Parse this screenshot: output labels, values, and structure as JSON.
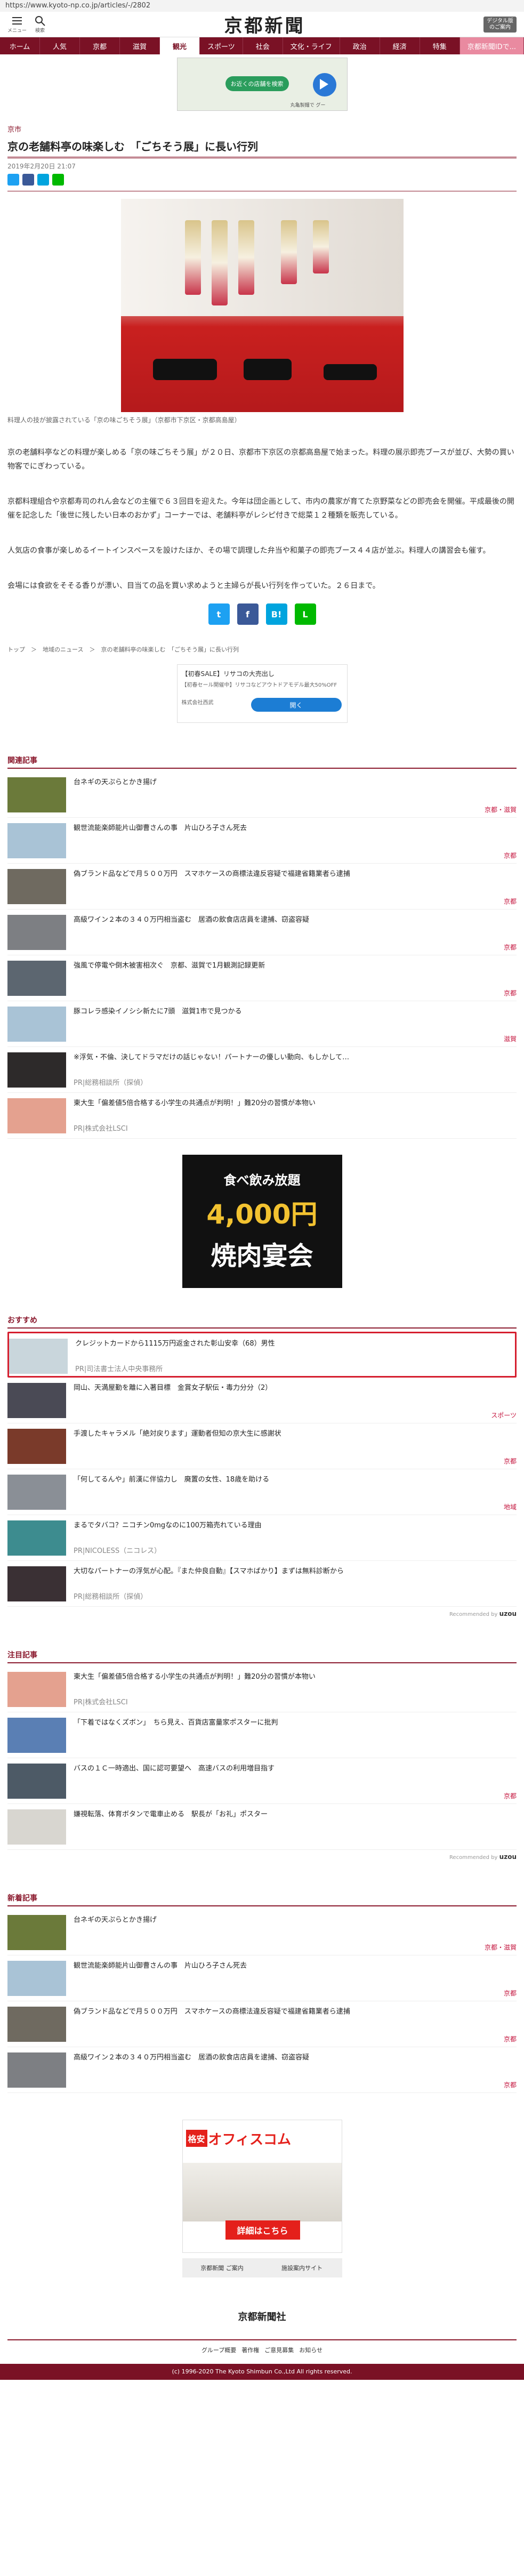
{
  "url": "https://www.kyoto-np.co.jp/articles/-/2802",
  "header": {
    "menu_label": "メニュー",
    "search_label": "検索",
    "logo": "京都新聞",
    "digital": "デジタル版\nのご案内"
  },
  "nav": [
    "ホーム",
    "人気",
    "京都",
    "滋賀",
    "観光",
    "スポーツ",
    "社会",
    "文化・ライフ",
    "政治",
    "経済",
    "特集",
    "京都新聞IDで..."
  ],
  "mapad": {
    "button": "お近くの店舗を検索",
    "caption": "丸亀製麺で グー"
  },
  "article": {
    "section": "京市",
    "title": "京の老舗料亭の味楽しむ　「ごちそう展」に長い行列",
    "date": "2019年2月20日 21:07",
    "caption": "料理人の技が披露されている「京の味ごちそう展」（京都市下京区・京都高島屋）",
    "p1": "京の老舗料亭などの料理が楽しめる「京の味ごちそう展」が２０日、京都市下京区の京都高島屋で始まった。料理の展示即売ブースが並び、大勢の買い物客でにぎわっている。",
    "p2": "京都料理組合や京都寿司のれん会などの主催で６３回目を迎えた。今年は団企画として、市内の農家が育てた京野菜などの即売会を開催。平成最後の開催を記念した「後世に残したい日本のおかず」コーナーでは、老舗料亭がレシピ付きで総菜１２種類を販売している。",
    "p3": "人気店の食事が楽しめるイートインスペースを設けたほか、その場で調理した弁当や和菓子の即売ブース４４店が並ぶ。料理人の講習会も催す。",
    "p4": "会場には食欲をそそる香りが漂い、目当ての品を買い求めようと主婦らが長い行列を作っていた。２６日まで。",
    "crumb": "トップ　＞　地域のニュース　＞　京の老舗料亭の味楽しむ　「ごちそう展」に長い行列"
  },
  "share": [
    "t",
    "f",
    "B!",
    "L"
  ],
  "ad_small": {
    "line1": "【初春SALE】リサコの大売出し",
    "line2": "【初春セール開催中】リサコなどアウトドアモデル最大50%OFF",
    "line3": "株式会社西武",
    "button": "開く"
  },
  "related": {
    "heading": "関連記事",
    "items": [
      {
        "title": "台ネギの天ぷらとかき揚げ",
        "tag": "京都・滋賀"
      },
      {
        "title": "観世流能楽師能片山御曹さんの事　片山ひろ子さん死去",
        "tag": "京都"
      },
      {
        "title": "偽ブランド品などで月５００万円　スマホケースの商標法違反容疑で福建省籍業者ら逮捕",
        "tag": "京都"
      },
      {
        "title": "高級ワイン２本の３４０万円相当盗む　居酒の飲食店店員を逮捕、窃盗容疑",
        "tag": "京都"
      },
      {
        "title": "強風で停電や倒木被害相次ぐ　京都、滋賀で1月観測記録更新",
        "tag": "京都"
      },
      {
        "title": "豚コレラ感染イノシシ新たに7頭　滋賀1市で見つかる",
        "tag": "滋賀"
      },
      {
        "title": "※浮気・不倫、決してドラマだけの話じゃない！パートナーの優しい動向、もしかして…",
        "pr": "PR|総務相談所（探偵）"
      },
      {
        "title": "東大生「偏差値5倍合格する小学生の共通点が判明！」難20分の習慣が本物い",
        "pr": "PR|株式会社LSCI"
      }
    ]
  },
  "bigad": {
    "l1": "食べ飲み放題",
    "l2": "4,000円",
    "l3": "焼肉宴会"
  },
  "recommend": {
    "heading": "おすすめ",
    "items": [
      {
        "title": "クレジットカードから1115万円返金された彰山安幸（68）男性",
        "pr": "PR|司法書士法人中央事務所"
      },
      {
        "title": "岡山、天満屋勤を離に入著目標　金賞女子駅伝・毒力分分（2）",
        "tag": "スポーツ"
      },
      {
        "title": "手渡したキャラメル「絶対戻ります」運動者但知の京大生に感謝状",
        "tag": "京都"
      },
      {
        "title": "「何してるんや」前漢に伴協力し　廃置の女性、18歳を助ける",
        "tag": "地域"
      },
      {
        "title": "まるでタバコ？ニコチン0mgなのに100万箱売れている理由",
        "pr": "PR|NICOLESS（ニコレス）"
      },
      {
        "title": "大切なパートナーの浮気が心配。『また仲良自動』【スマホばかり】まずは無料診断から",
        "pr": "PR|総務相談所（探偵）"
      }
    ],
    "recby": "Recommended by",
    "recbrand": "uzou"
  },
  "attention": {
    "heading": "注目記事",
    "items": [
      {
        "title": "東大生「偏差値5倍合格する小学生の共通点が判明！」難20分の習慣が本物い",
        "pr": "PR|株式会社LSCI"
      },
      {
        "title": "「下着ではなくズボン」　ちら見え、百貨店富量家ポスターに批判",
        "tag": ""
      },
      {
        "title": "バスの１Ｃ一時適出、国に認可要望へ　高速バスの利用増目指す",
        "tag": "京都"
      },
      {
        "title": "嫌視転落、体育ボタンで電車止める　駅長が「お礼」ポスター",
        "tag": ""
      }
    ],
    "recby": "Recommended by",
    "recbrand": "uzou"
  },
  "latest": {
    "heading": "新着記事",
    "items": [
      {
        "title": "台ネギの天ぷらとかき揚げ",
        "tag": "京都・滋賀"
      },
      {
        "title": "観世流能楽師能片山御曹さんの事　片山ひろ子さん死去",
        "tag": "京都"
      },
      {
        "title": "偽ブランド品などで月５００万円　スマホケースの商標法違反容疑で福建省籍業者ら逮捕",
        "tag": "京都"
      },
      {
        "title": "高級ワイン２本の３４０万円相当盗む　居酒の飲食店店員を逮捕、窃盗容疑",
        "tag": "京都"
      }
    ]
  },
  "officead": {
    "badge": "格安",
    "brand": "オフィスコム",
    "button": "詳細はこちら"
  },
  "subtabs": [
    "京都新聞 ご案内",
    "施設案内サイト"
  ],
  "footer": {
    "logo": "京都新聞社",
    "links": [
      "グループ概要",
      "著作権",
      "ご意見募集",
      "お知らせ"
    ],
    "copy": "(c) 1996-2020 The Kyoto Shimbun Co.,Ltd All rights reserved."
  },
  "colors": {
    "brand": "#7a1125",
    "accent": "#c4143d",
    "highlight": "#d51e2e"
  }
}
